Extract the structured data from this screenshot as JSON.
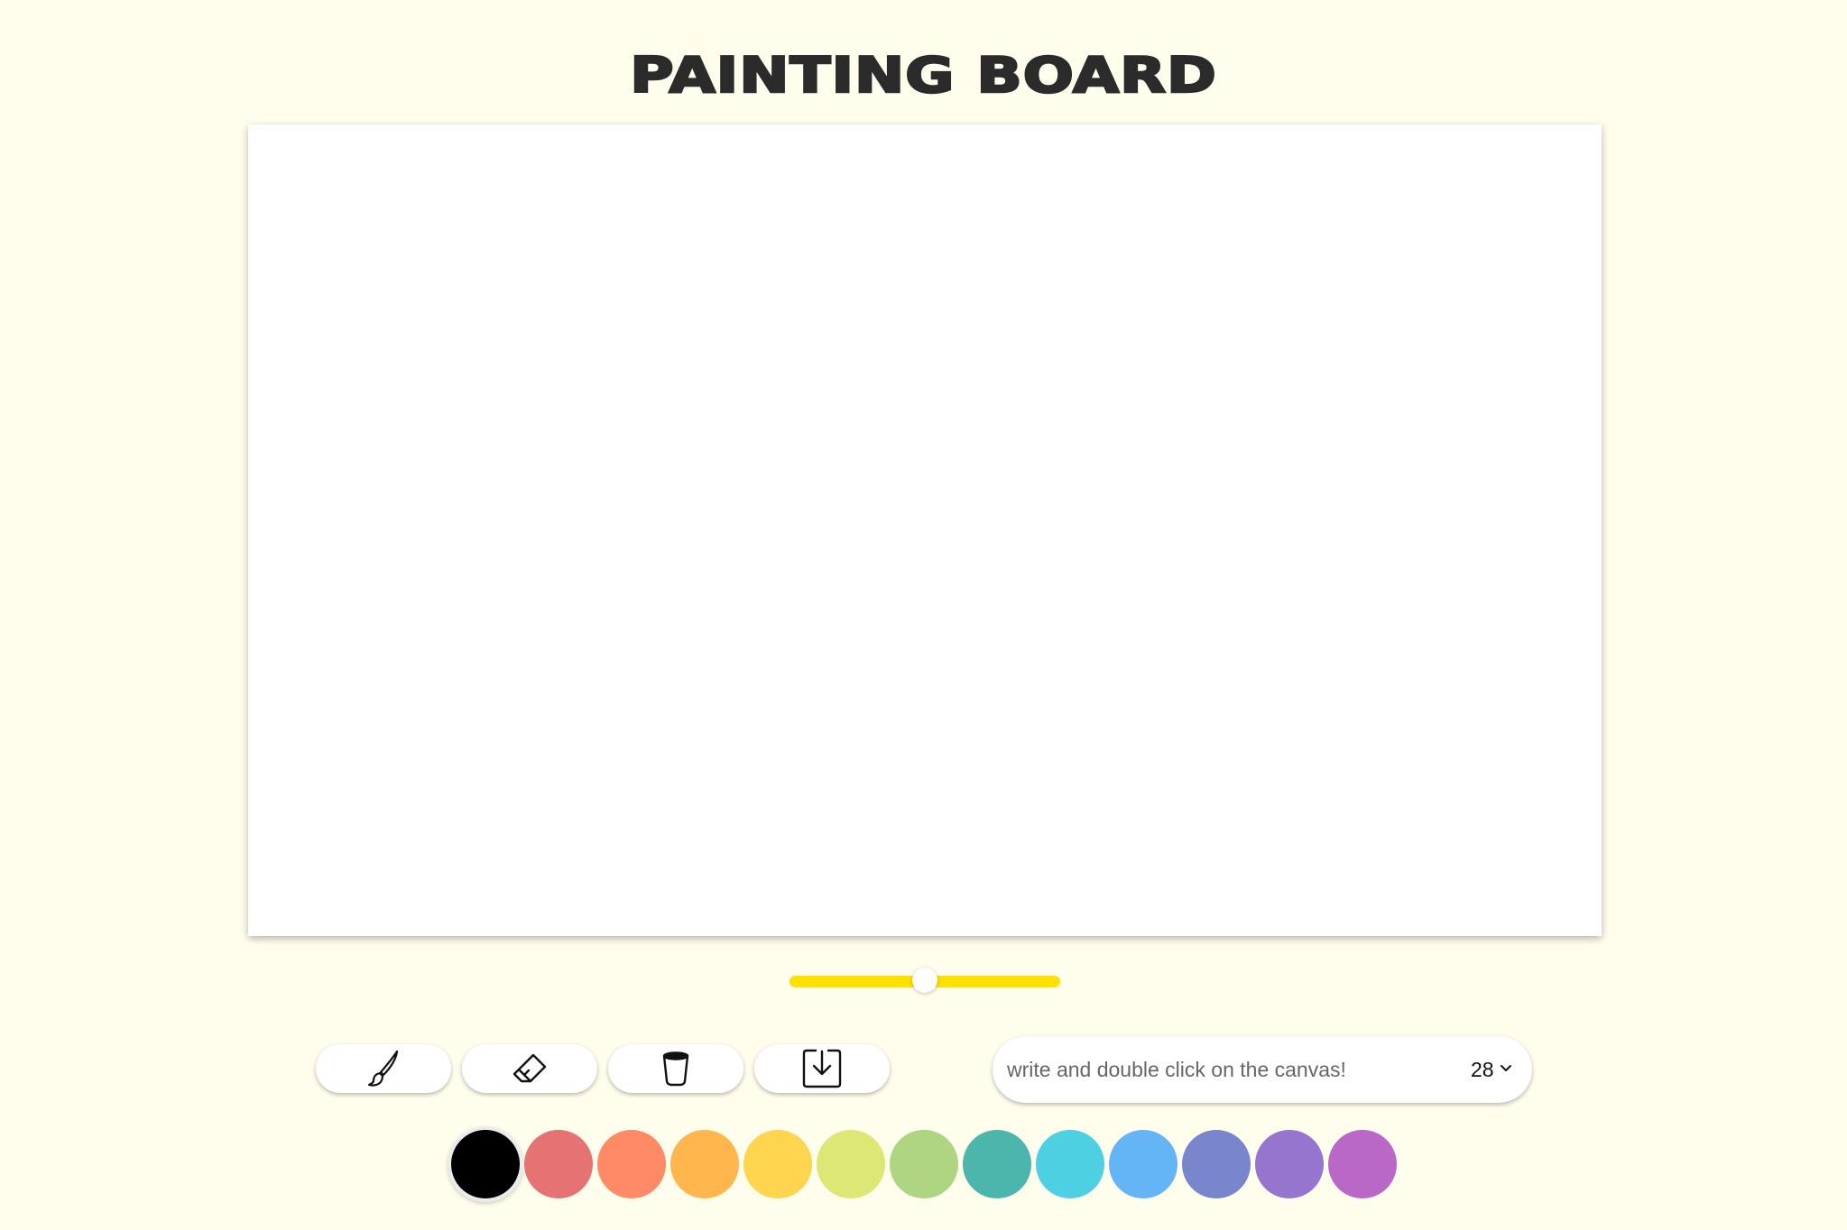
{
  "title": "PAINTING BOARD",
  "brush_size_slider": {
    "value": 0.5
  },
  "toolbar": {
    "tools": [
      {
        "name": "brush",
        "icon": "paintbrush-icon"
      },
      {
        "name": "eraser",
        "icon": "eraser-icon"
      },
      {
        "name": "clear",
        "icon": "trash-bin-icon"
      },
      {
        "name": "download",
        "icon": "download-icon"
      }
    ]
  },
  "text_tool": {
    "placeholder": "write and double click on the canvas!",
    "font_size": "28"
  },
  "palette": {
    "selected_index": 0,
    "colors": [
      "#000000",
      "#e57373",
      "#ff8a65",
      "#ffb74d",
      "#ffd54f",
      "#dce775",
      "#aed581",
      "#4db6ac",
      "#4dd0e1",
      "#64b5f6",
      "#7986cb",
      "#9575cd",
      "#ba68c8"
    ]
  },
  "accent": "#ffe100"
}
